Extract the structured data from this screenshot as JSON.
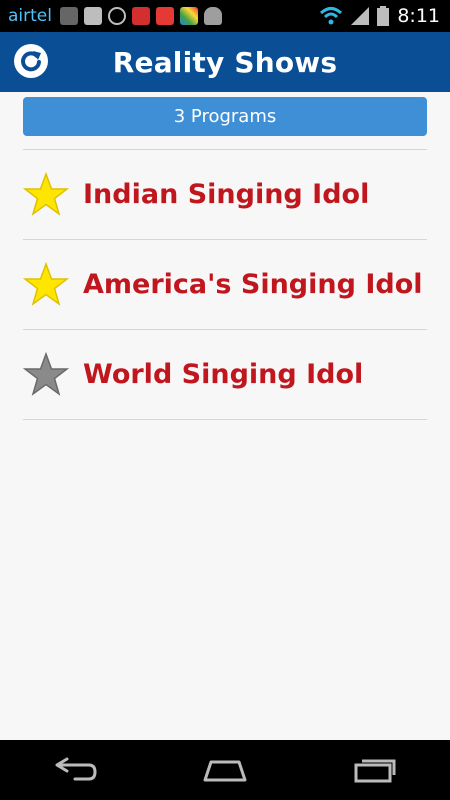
{
  "status_bar": {
    "carrier": "airtel",
    "time": "8:11",
    "icons": [
      "storage-icon",
      "message-icon",
      "sync-icon",
      "app-icon-1",
      "app-icon-2",
      "app-icon-3",
      "android-icon",
      "wifi-icon",
      "signal-icon",
      "battery-icon"
    ]
  },
  "app_bar": {
    "title": "Reality Shows",
    "refresh_icon": "refresh-icon"
  },
  "header": {
    "count_label": "3 Programs"
  },
  "programs": [
    {
      "name": "Indian Singing Idol",
      "starred": true
    },
    {
      "name": "America's Singing Idol",
      "starred": true
    },
    {
      "name": "World Singing Idol",
      "starred": false
    }
  ],
  "nav": {
    "buttons": [
      "back-icon",
      "home-icon",
      "recent-apps-icon"
    ]
  },
  "colors": {
    "app_bar": "#0a4f96",
    "pill": "#3f8fd6",
    "program_text": "#c0161e",
    "star_on": "#ffe600",
    "star_off": "#8a8a8a"
  }
}
